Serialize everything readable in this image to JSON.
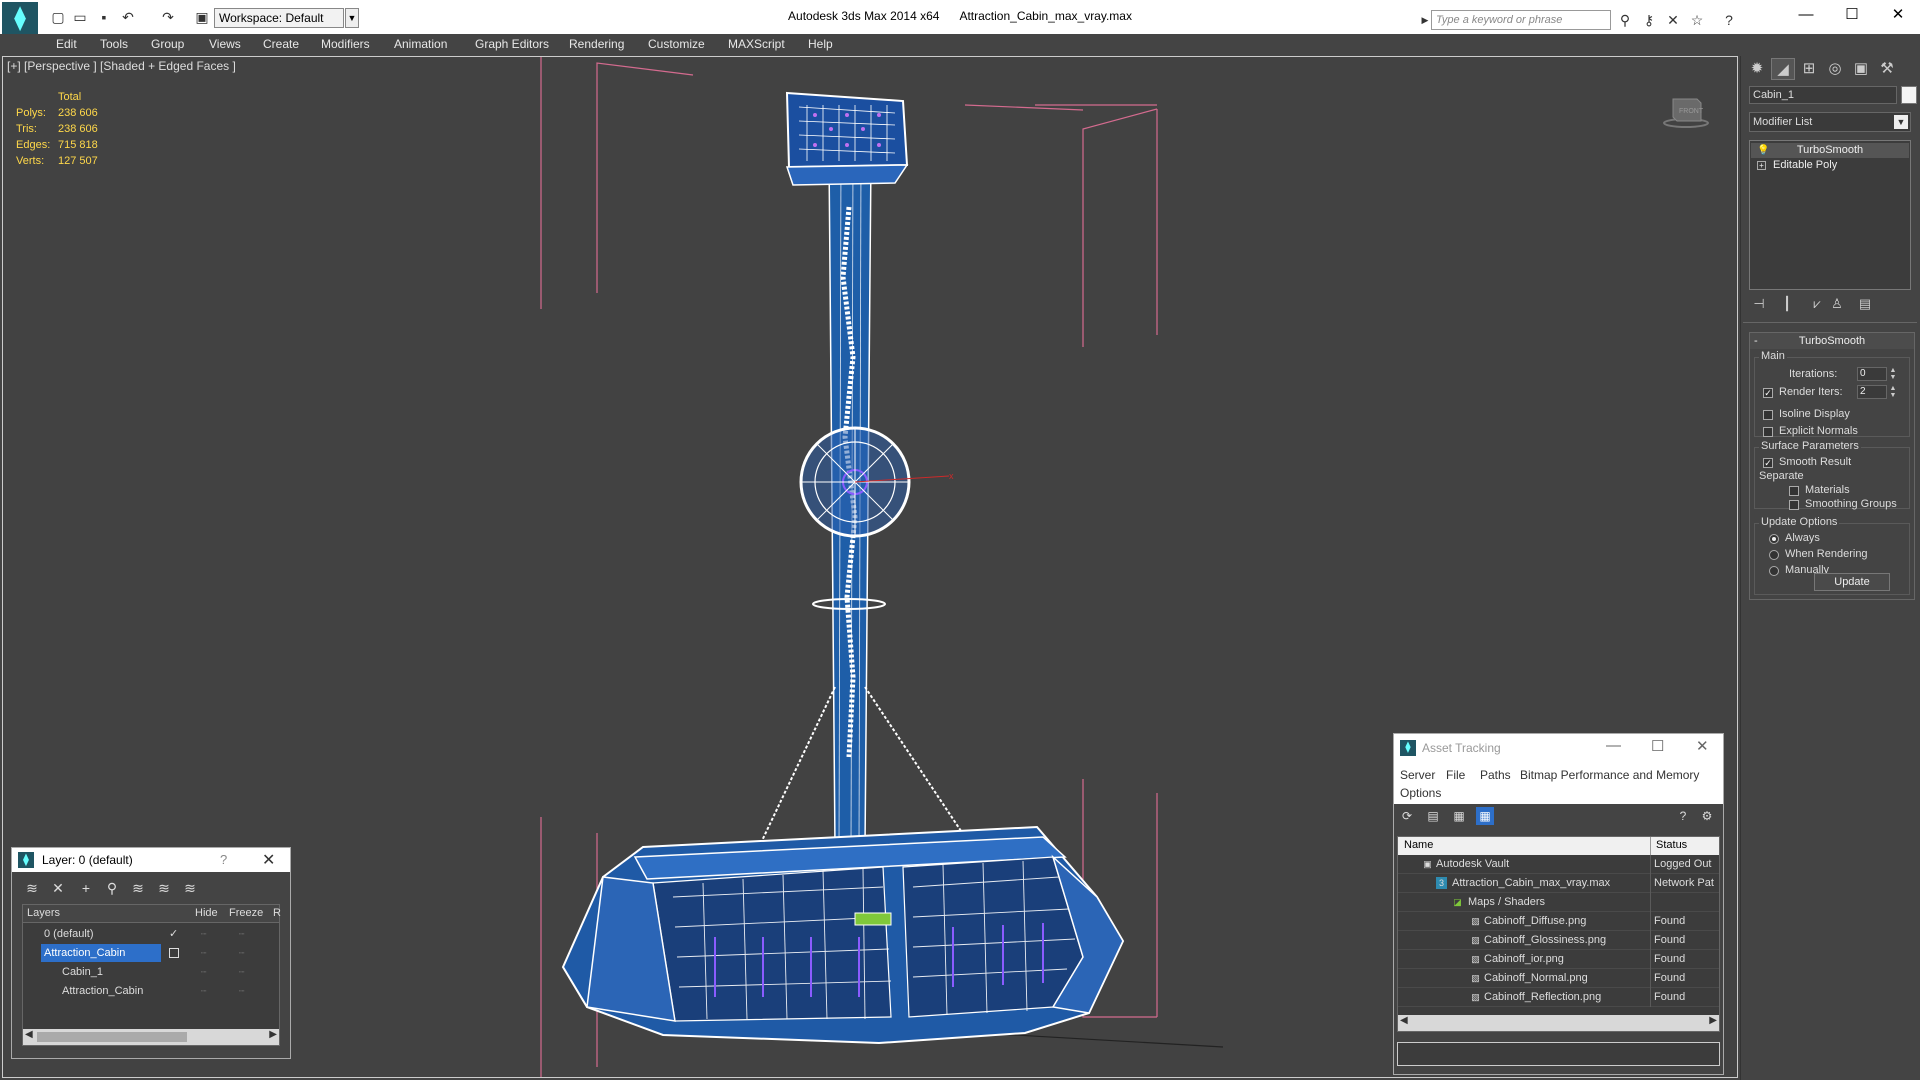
{
  "app": {
    "title": "Autodesk 3ds Max  2014 x64",
    "file": "Attraction_Cabin_max_vray.max",
    "workspace": "Workspace: Default",
    "search_placeholder": "Type a keyword or phrase"
  },
  "menu": [
    "Edit",
    "Tools",
    "Group",
    "Views",
    "Create",
    "Modifiers",
    "Animation",
    "Graph Editors",
    "Rendering",
    "Customize",
    "MAXScript",
    "Help"
  ],
  "viewport": {
    "label": "[+] [Perspective ] [Shaded + Edged Faces ]",
    "cube_label": "FRONT",
    "stats": {
      "header": "Total",
      "rows": [
        {
          "k": "Polys:",
          "v": "238 606"
        },
        {
          "k": "Tris:",
          "v": "238 606"
        },
        {
          "k": "Edges:",
          "v": "715 818"
        },
        {
          "k": "Verts:",
          "v": "127 507"
        }
      ]
    }
  },
  "command_panel": {
    "object_name": "Cabin_1",
    "modifier_list": "Modifier List",
    "stack": [
      "TurboSmooth",
      "Editable Poly"
    ],
    "rollout_title": "TurboSmooth",
    "main_group": "Main",
    "iterations_label": "Iterations:",
    "iterations_value": "0",
    "render_iters_label": "Render Iters:",
    "render_iters_value": "2",
    "isoline": "Isoline Display",
    "explicit": "Explicit Normals",
    "surface_group": "Surface Parameters",
    "smooth_result": "Smooth Result",
    "separate": "Separate",
    "materials": "Materials",
    "smoothing_groups": "Smoothing Groups",
    "update_group": "Update Options",
    "always": "Always",
    "when_rendering": "When Rendering",
    "manually": "Manually",
    "update_btn": "Update"
  },
  "layer_window": {
    "title": "Layer: 0 (default)",
    "help": "?",
    "columns": {
      "layers": "Layers",
      "hide": "Hide",
      "freeze": "Freeze",
      "r": "R"
    },
    "rows": [
      {
        "name": "0 (default)"
      },
      {
        "name": "Attraction_Cabin"
      },
      {
        "name": "Cabin_1"
      },
      {
        "name": "Attraction_Cabin"
      }
    ]
  },
  "asset_window": {
    "title": "Asset Tracking",
    "menu": [
      "Server",
      "File",
      "Paths",
      "Bitmap Performance and Memory",
      "Options"
    ],
    "columns": {
      "name": "Name",
      "status": "Status"
    },
    "rows": [
      {
        "name": "Autodesk Vault",
        "status": "Logged Out"
      },
      {
        "name": "Attraction_Cabin_max_vray.max",
        "status": "Network Pat"
      },
      {
        "name": "Maps / Shaders",
        "status": ""
      },
      {
        "name": "Cabinoff_Diffuse.png",
        "status": "Found"
      },
      {
        "name": "Cabinoff_Glossiness.png",
        "status": "Found"
      },
      {
        "name": "Cabinoff_ior.png",
        "status": "Found"
      },
      {
        "name": "Cabinoff_Normal.png",
        "status": "Found"
      },
      {
        "name": "Cabinoff_Reflection.png",
        "status": "Found"
      }
    ]
  }
}
